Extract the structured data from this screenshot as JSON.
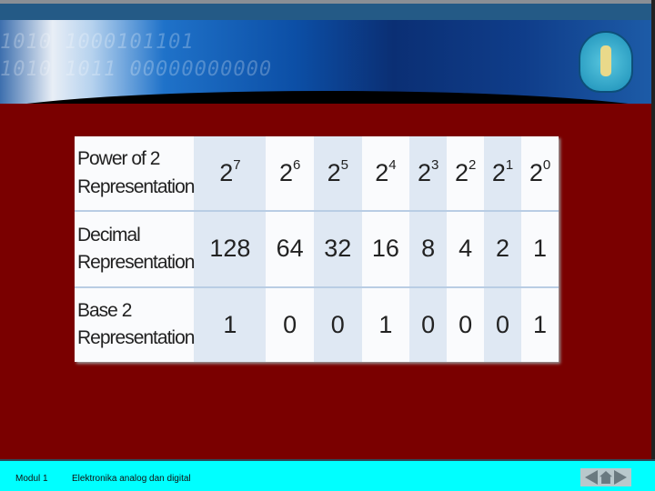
{
  "banner": {
    "bits_line1": "1010  1000101101",
    "bits_line2": "1010  1011 00000000000"
  },
  "table": {
    "rows": [
      {
        "label": "Power of 2 Representation",
        "cells": [
          {
            "b": "2",
            "e": "7"
          },
          {
            "b": "2",
            "e": "6"
          },
          {
            "b": "2",
            "e": "5"
          },
          {
            "b": "2",
            "e": "4"
          },
          {
            "b": "2",
            "e": "3"
          },
          {
            "b": "2",
            "e": "2"
          },
          {
            "b": "2",
            "e": "1"
          },
          {
            "b": "2",
            "e": "0"
          }
        ]
      },
      {
        "label": "Decimal Representation",
        "cells": [
          "128",
          "64",
          "32",
          "16",
          "8",
          "4",
          "2",
          "1"
        ]
      },
      {
        "label": "Base 2 Representation",
        "cells": [
          "1",
          "0",
          "0",
          "1",
          "0",
          "0",
          "0",
          "1"
        ]
      }
    ]
  },
  "footer": {
    "module": "Modul 1",
    "title": "Elektronika analog dan digital",
    "nav_icons": [
      "prev-arrow-icon",
      "home-icon",
      "next-arrow-icon"
    ]
  },
  "colors": {
    "background": "#7a0000",
    "footer": "#00ffff",
    "header": "#245a86"
  }
}
